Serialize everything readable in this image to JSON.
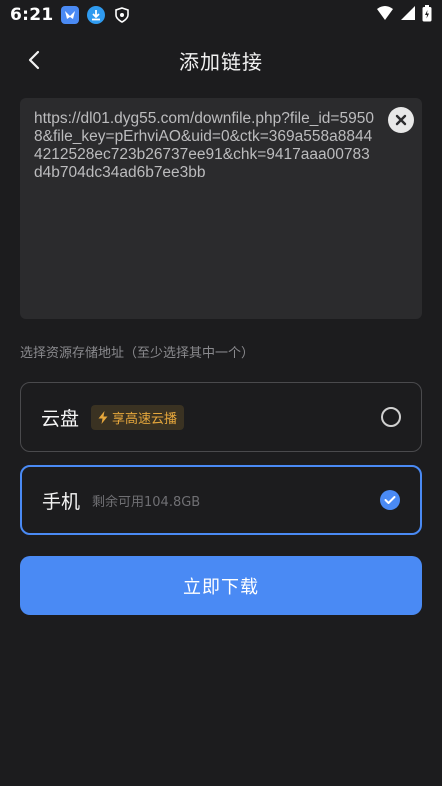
{
  "status_bar": {
    "time": "6:21",
    "icons": [
      "bird-app-icon",
      "download-app-icon",
      "shield-app-icon"
    ],
    "right_icons": [
      "wifi-icon",
      "signal-icon",
      "battery-icon"
    ]
  },
  "header": {
    "title": "添加链接",
    "back_icon": "chevron-left-icon"
  },
  "link_input": {
    "value": "https://dl01.dyg55.com/downfile.php?file_id=59508&file_key=pErhviAO&uid=0&ctk=369a558a88444212528ec723b26737ee91&chk=9417aaa00783d4b704dc34ad6b7ee3bb",
    "clear_icon": "close-circle-icon"
  },
  "storage": {
    "hint": "选择资源存储地址（至少选择其中一个）",
    "options": [
      {
        "label": "云盘",
        "badge": "享高速云播",
        "badge_icon": "lightning-icon",
        "selected": false
      },
      {
        "label": "手机",
        "detail": "剩余可用104.8GB",
        "selected": true
      }
    ]
  },
  "actions": {
    "download_label": "立即下载"
  },
  "colors": {
    "accent": "#4a8af4",
    "badge_text": "#e6a73c",
    "background": "#1c1c1e"
  }
}
